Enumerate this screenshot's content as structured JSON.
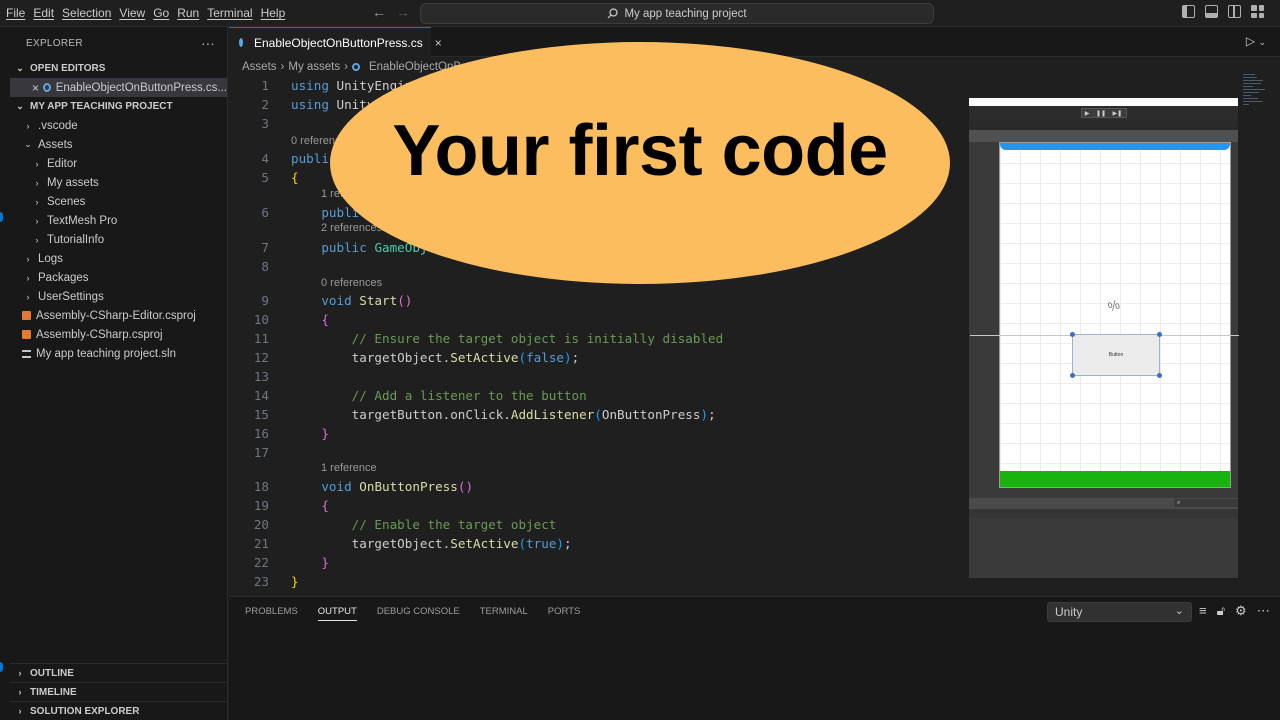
{
  "menu": [
    "File",
    "Edit",
    "Selection",
    "View",
    "Go",
    "Run",
    "Terminal",
    "Help"
  ],
  "search_text": "My app teaching project",
  "explorer": {
    "title": "EXPLORER",
    "more": "···",
    "open_editors_label": "OPEN EDITORS",
    "open_file": "EnableObjectOnButtonPress.cs...",
    "project_label": "MY APP TEACHING PROJECT",
    "tree": [
      {
        "label": ".vscode",
        "kind": "folder",
        "chev": "›",
        "indent": 0
      },
      {
        "label": "Assets",
        "kind": "folder",
        "chev": "⌄",
        "indent": 0
      },
      {
        "label": "Editor",
        "kind": "folder",
        "chev": "›",
        "indent": 1
      },
      {
        "label": "My assets",
        "kind": "folder",
        "chev": "›",
        "indent": 1
      },
      {
        "label": "Scenes",
        "kind": "folder",
        "chev": "›",
        "indent": 1
      },
      {
        "label": "TextMesh Pro",
        "kind": "folder",
        "chev": "›",
        "indent": 1
      },
      {
        "label": "TutorialInfo",
        "kind": "folder",
        "chev": "›",
        "indent": 1
      },
      {
        "label": "Logs",
        "kind": "folder",
        "chev": "›",
        "indent": 0
      },
      {
        "label": "Packages",
        "kind": "folder",
        "chev": "›",
        "indent": 0
      },
      {
        "label": "UserSettings",
        "kind": "folder",
        "chev": "›",
        "indent": 0
      },
      {
        "label": "Assembly-CSharp-Editor.csproj",
        "kind": "rss",
        "chev": "",
        "indent": 0
      },
      {
        "label": "Assembly-CSharp.csproj",
        "kind": "rss",
        "chev": "",
        "indent": 0
      },
      {
        "label": "My app teaching project.sln",
        "kind": "sln",
        "chev": "",
        "indent": 0
      }
    ],
    "bottom_sections": [
      "OUTLINE",
      "TIMELINE",
      "SOLUTION EXPLORER"
    ]
  },
  "tab": {
    "label": "EnableObjectOnButtonPress.cs",
    "close": "×"
  },
  "breadcrumb": [
    "Assets",
    "My assets",
    "EnableObjectOnBut"
  ],
  "code": {
    "line_numbers": [
      "1",
      "2",
      "3",
      "4",
      "5",
      "6",
      "7",
      "8",
      "9",
      "10",
      "11",
      "12",
      "13",
      "14",
      "15",
      "16",
      "17",
      "18",
      "19",
      "20",
      "21",
      "22",
      "23"
    ],
    "lens": {
      "l4": "0 references",
      "l6": "1 reference",
      "l7": "2 references",
      "l9": "0 references",
      "l18": "1 reference"
    }
  },
  "overlay_title": "Your first code",
  "unity_preview": {
    "button_label": "Button"
  },
  "panel": {
    "tabs": [
      "PROBLEMS",
      "OUTPUT",
      "DEBUG CONSOLE",
      "TERMINAL",
      "PORTS"
    ],
    "active_tab": "OUTPUT",
    "output_channel": "Unity"
  },
  "colors": {
    "accent": "#0078d4",
    "overlay": "#fbbd5d",
    "unity_green": "#19b30e",
    "unity_blue": "#2196f3"
  }
}
